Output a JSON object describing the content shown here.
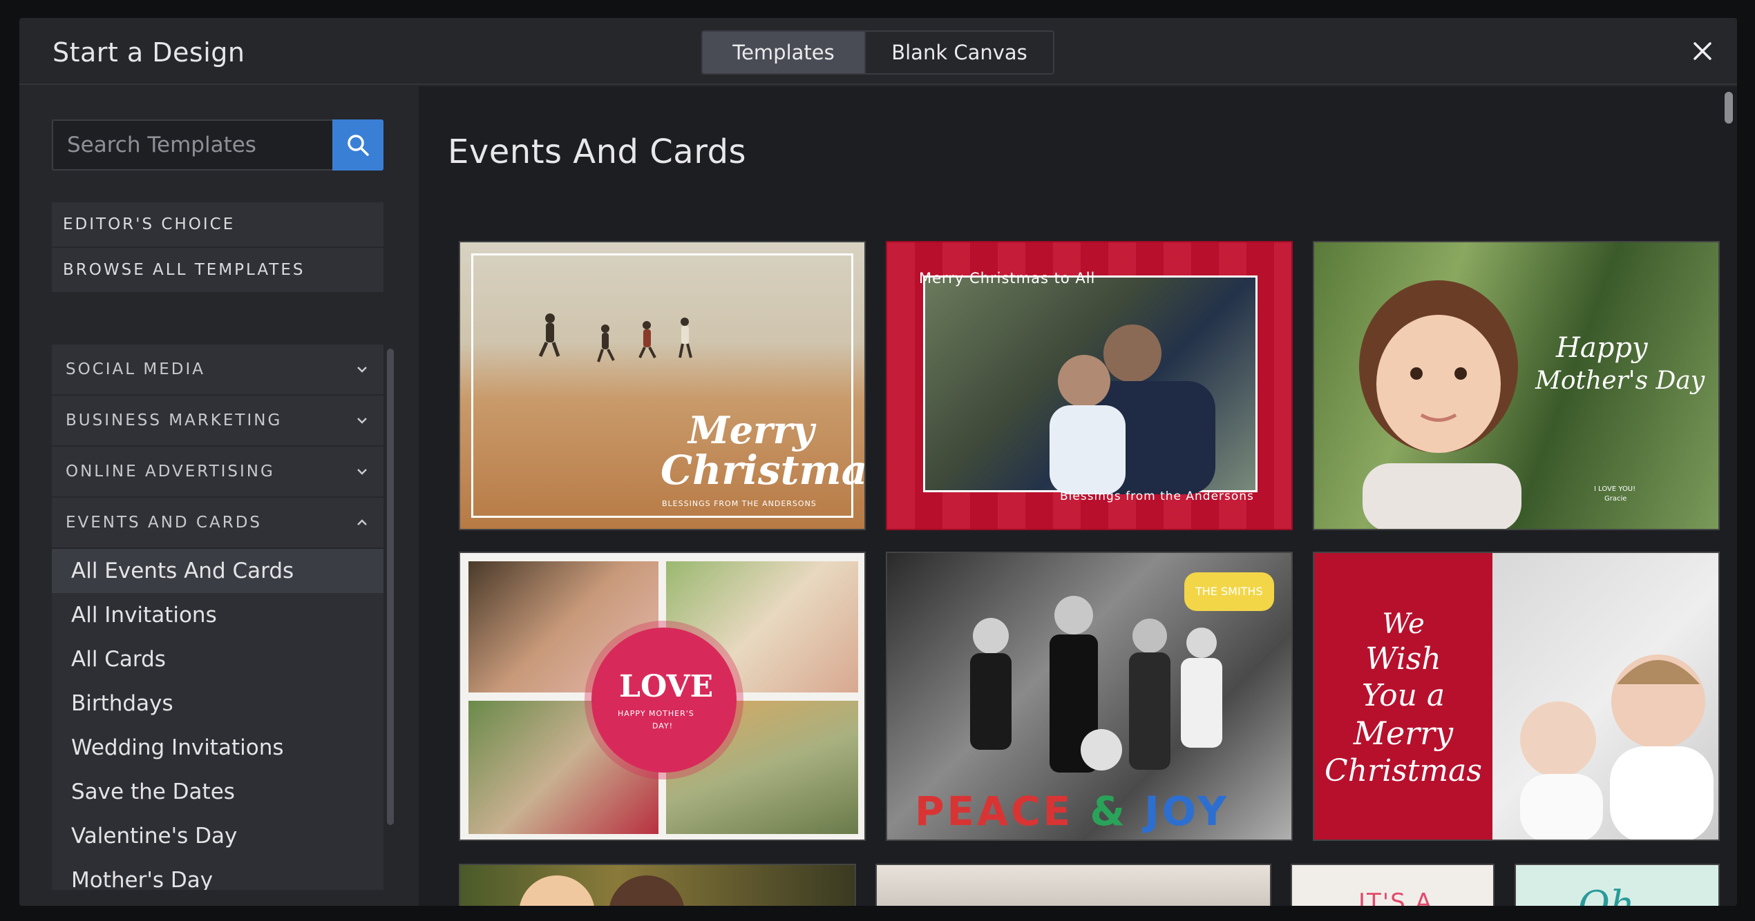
{
  "modal": {
    "title": "Start a Design",
    "tabs": [
      {
        "label": "Templates",
        "active": true
      },
      {
        "label": "Blank Canvas",
        "active": false
      }
    ]
  },
  "sidebar": {
    "search_placeholder": "Search Templates",
    "quick_links": [
      "EDITOR'S CHOICE",
      "BROWSE ALL TEMPLATES"
    ],
    "categories": [
      {
        "label": "SOCIAL MEDIA",
        "expanded": false
      },
      {
        "label": "BUSINESS MARKETING",
        "expanded": false
      },
      {
        "label": "ONLINE ADVERTISING",
        "expanded": false
      },
      {
        "label": "EVENTS AND CARDS",
        "expanded": true
      }
    ],
    "events_subitems": [
      "All Events And Cards",
      "All Invitations",
      "All Cards",
      "Birthdays",
      "Wedding Invitations",
      "Save the Dates",
      "Valentine's Day",
      "Mother's Day"
    ],
    "active_subitem": "All Events And Cards"
  },
  "main": {
    "section_title": "Events And Cards",
    "cards": {
      "c1": {
        "line1": "Merry",
        "line2": "Christmas",
        "line3": "BLESSINGS FROM THE ANDERSONS"
      },
      "c2": {
        "top": "Merry Christmas to All",
        "bottom": "Blessings from the Andersons"
      },
      "c3": {
        "line1": "Happy",
        "line2": "Mother's Day",
        "line3": "I LOVE YOU!",
        "line4": "Gracie"
      },
      "c4": {
        "big": "LOVE",
        "small1": "HAPPY MOTHER'S",
        "small2": "DAY!"
      },
      "c5": {
        "tag": "THE SMITHS",
        "peace": "PEACE",
        "amp": "&",
        "joy": "JOY"
      },
      "c6": {
        "tree": [
          "We",
          "Wish",
          "You a",
          "Merry",
          "Christmas"
        ]
      },
      "c9": {
        "line1": "IT'S A"
      },
      "c10": {
        "line1": "Oh"
      }
    }
  },
  "colors": {
    "accent_blue": "#3a7fd6",
    "card_red": "#b7102d",
    "peace_letters": [
      "#d93434",
      "#2d6fd0",
      "#2aa35a",
      "#d93434",
      "#2d6fd0"
    ]
  }
}
